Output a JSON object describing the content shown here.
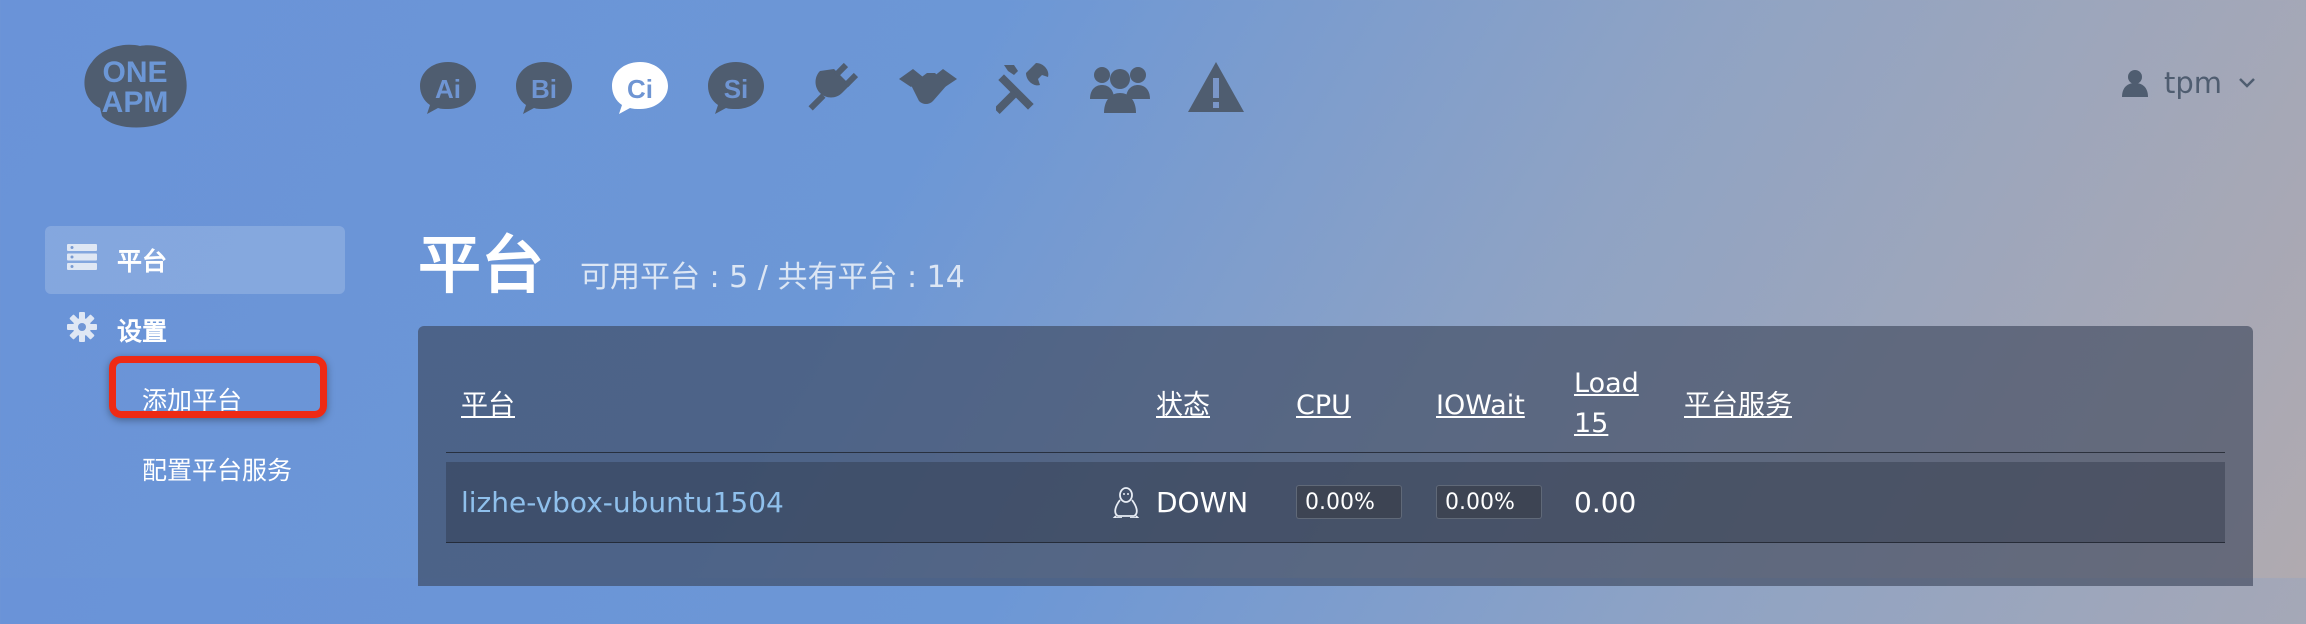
{
  "brand": {
    "logo_line1": "ONE",
    "logo_line2": "APM"
  },
  "topnav": {
    "items": [
      {
        "icon": "ai-icon",
        "text": "Ai"
      },
      {
        "icon": "bi-icon",
        "text": "Bi"
      },
      {
        "icon": "ci-icon",
        "text": "Ci",
        "active": true
      },
      {
        "icon": "si-icon",
        "text": "Si"
      },
      {
        "icon": "plug-icon",
        "text": ""
      },
      {
        "icon": "handshake-icon",
        "text": ""
      },
      {
        "icon": "tools-icon",
        "text": ""
      },
      {
        "icon": "users-icon",
        "text": ""
      },
      {
        "icon": "warning-icon",
        "text": ""
      }
    ]
  },
  "user": {
    "name": "tpm"
  },
  "sidebar": {
    "platform_label": "平台",
    "settings_label": "设置",
    "sub_items": [
      "添加平台",
      "配置平台服务"
    ]
  },
  "page": {
    "title": "平台",
    "summary": "可用平台 : 5 / 共有平台 : 14"
  },
  "table": {
    "headers": {
      "platform": "平台",
      "status": "状态",
      "cpu": "CPU",
      "iowait": "IOWait",
      "load15_line1": "Load",
      "load15_line2": "15",
      "services": "平台服务"
    },
    "rows": [
      {
        "name": "lizhe-vbox-ubuntu1504",
        "os_icon": "linux-penguin-icon",
        "status": "DOWN",
        "cpu": "0.00%",
        "iowait": "0.00%",
        "load15": "0.00"
      }
    ]
  },
  "colors": {
    "accent_link": "#8fc0ec",
    "highlight_box": "#ee2a14",
    "icon_dark": "#4f5d70"
  }
}
